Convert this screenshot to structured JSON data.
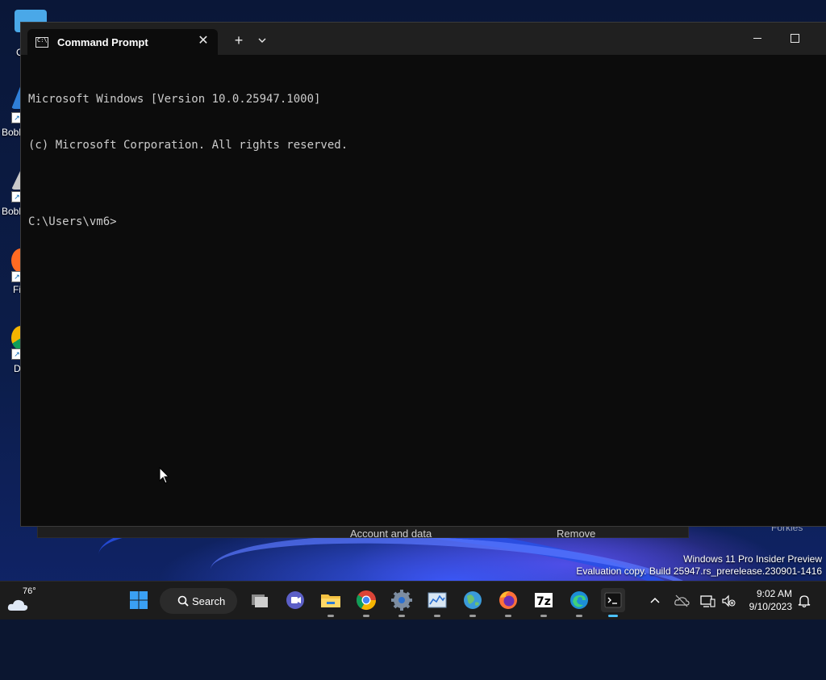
{
  "desktop": {
    "icons": [
      {
        "label": "C"
      },
      {
        "label": "Bobl"
      },
      {
        "label": "Bobl"
      },
      {
        "label": "Fi"
      },
      {
        "label": "D"
      }
    ],
    "background_window": {
      "text_account": "Account and data",
      "text_remove": "Remove",
      "text_right": "Forkies"
    }
  },
  "terminal": {
    "tab_title": "Command Prompt",
    "tab_icon_text": "C:\\",
    "new_tab_label": "+",
    "close_label": "✕",
    "lines": [
      "Microsoft Windows [Version 10.0.25947.1000]",
      "(c) Microsoft Corporation. All rights reserved.",
      "",
      "C:\\Users\\vm6>"
    ]
  },
  "watermark": {
    "line1": "Windows 11 Pro Insider Preview",
    "line2": "Evaluation copy. Build 25947.rs_prerelease.230901-1416"
  },
  "taskbar": {
    "weather_temp": "76°",
    "search_label": "Search",
    "apps": [
      {
        "name": "start-button"
      },
      {
        "name": "task-view"
      },
      {
        "name": "teams-chat"
      },
      {
        "name": "file-explorer"
      },
      {
        "name": "chrome"
      },
      {
        "name": "settings"
      },
      {
        "name": "task-manager"
      },
      {
        "name": "map-app"
      },
      {
        "name": "firefox"
      },
      {
        "name": "7zip"
      },
      {
        "name": "edge"
      },
      {
        "name": "terminal"
      }
    ],
    "clock_time": "9:02 AM",
    "clock_date": "9/10/2023"
  },
  "colors": {
    "terminal_bg": "#0c0c0c",
    "titlebar_bg": "#202020",
    "taskbar_bg": "#1c1c1c",
    "accent": "#4cc2ff"
  }
}
